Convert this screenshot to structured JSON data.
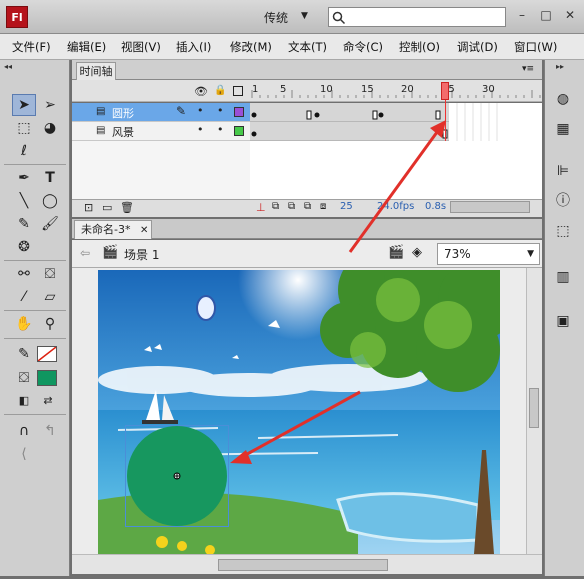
{
  "app": {
    "logo": "Fl",
    "workspace": "传统",
    "search_placeholder": ""
  },
  "window_buttons": [
    "–",
    "□",
    "✕"
  ],
  "menu": [
    "文件(F)",
    "编辑(E)",
    "视图(V)",
    "插入(I)",
    "修改(M)",
    "文本(T)",
    "命令(C)",
    "控制(O)",
    "调试(D)",
    "窗口(W)"
  ],
  "timeline": {
    "tab": "时间轴",
    "frame_numbers": [
      "1",
      "5",
      "10",
      "15",
      "20",
      "25",
      "30"
    ],
    "layers": [
      {
        "name": "圆形",
        "color": "#9b4fd6"
      },
      {
        "name": "风景",
        "color": "#47c94a"
      }
    ],
    "footer": {
      "current_frame": "25",
      "fps": "24.0fps",
      "time": "0.8s"
    }
  },
  "document": {
    "tab": "未命名-3*",
    "close": "✕",
    "scene": "场景 1",
    "zoom": "73%"
  },
  "colors": {
    "fill": "#0f9660",
    "stroke": "none"
  },
  "stage": {
    "circle_color": "#17975f"
  }
}
